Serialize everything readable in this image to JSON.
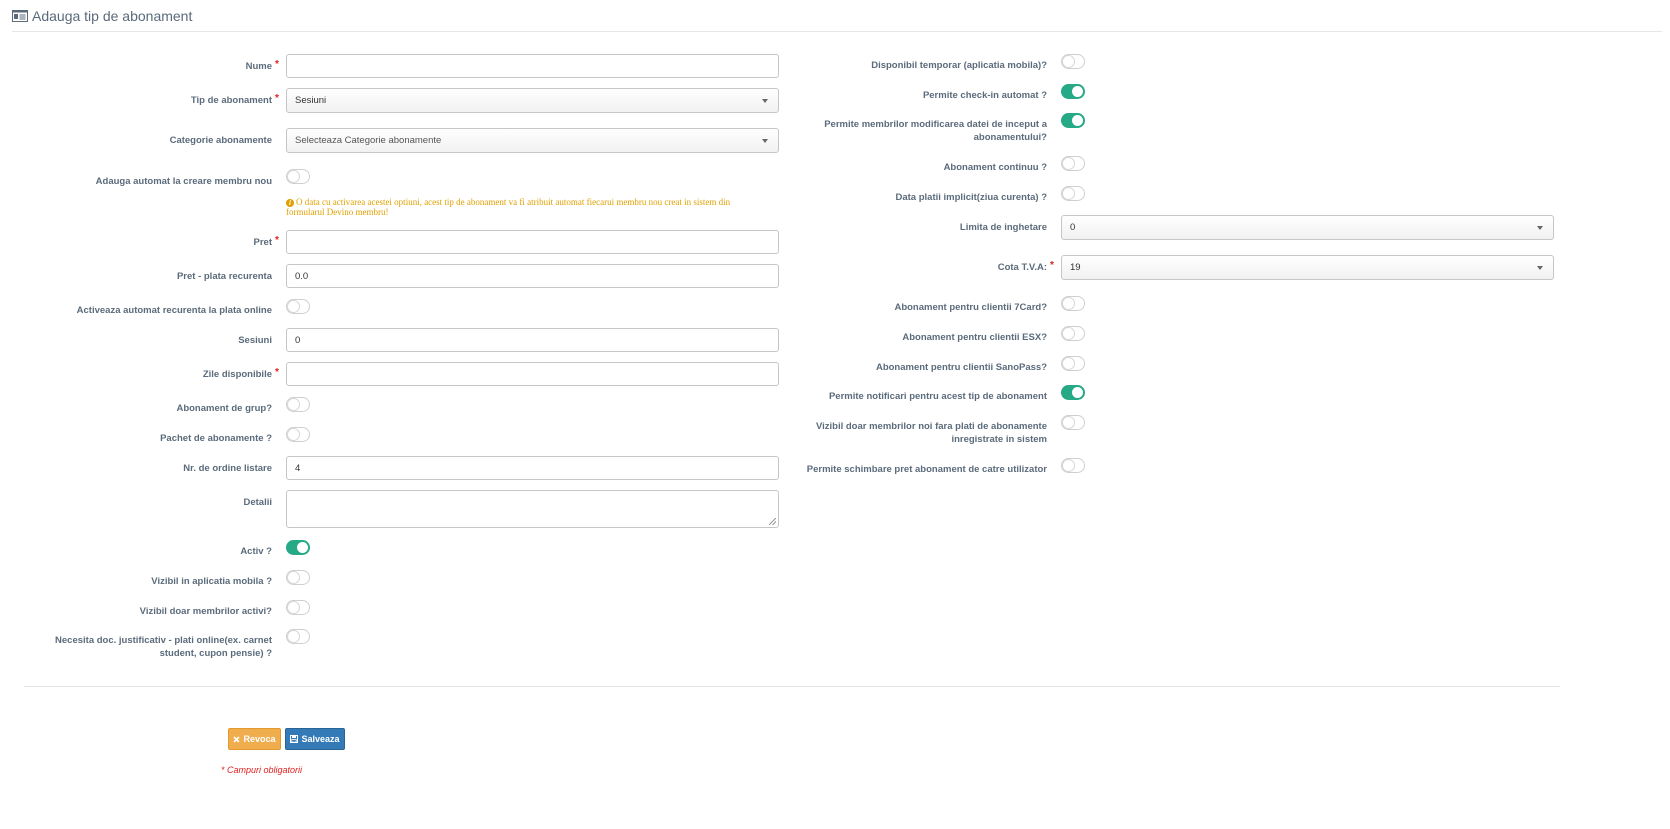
{
  "header": {
    "title": "Adauga tip de abonament",
    "icon": "id-card-icon"
  },
  "colors": {
    "accent": "#26a986",
    "required": "#e02020",
    "hint": "#e0a000",
    "cancel": "#f0ad4e",
    "save": "#337ab7"
  },
  "left": {
    "nume": {
      "label": "Nume",
      "value": ""
    },
    "tip": {
      "label": "Tip de abonament",
      "value": "Sesiuni"
    },
    "categorie": {
      "label": "Categorie abonamente",
      "value": "Selecteaza Categorie abonamente"
    },
    "adauga_auto": {
      "label": "Adauga automat la creare membru nou",
      "on": false
    },
    "hint": "O data cu activarea acestei optiuni, acest tip de abonament va fi atribuit automat fiecarui membru nou creat in sistem din formularul Devino membru!",
    "pret": {
      "label": "Pret",
      "value": ""
    },
    "pret_recurenta": {
      "label": "Pret - plata recurenta",
      "value": "0.0"
    },
    "activeaza_recurenta": {
      "label": "Activeaza automat recurenta la plata online",
      "on": false
    },
    "sesiuni": {
      "label": "Sesiuni",
      "value": "0"
    },
    "zile": {
      "label": "Zile disponibile",
      "value": ""
    },
    "grup": {
      "label": "Abonament de grup?",
      "on": false
    },
    "pachet": {
      "label": "Pachet de abonamente ?",
      "on": false
    },
    "ordine": {
      "label": "Nr. de ordine listare",
      "value": "4"
    },
    "detalii": {
      "label": "Detalii",
      "value": ""
    },
    "activ": {
      "label": "Activ ?",
      "on": true
    },
    "vizibil_app": {
      "label": "Vizibil in aplicatia mobila ?",
      "on": false
    },
    "vizibil_activi": {
      "label": "Vizibil doar membrilor activi?",
      "on": false
    },
    "necesita_doc": {
      "label_line1": "Necesita doc. justificativ - plati online(ex. carnet",
      "label_line2": "student, cupon pensie) ?",
      "on": false
    }
  },
  "right": {
    "disponibil_temp": {
      "label": "Disponibil temporar (aplicatia mobila)?",
      "on": false
    },
    "checkin": {
      "label": "Permite check-in automat ?",
      "on": true
    },
    "modificare_data": {
      "label_line1": "Permite membrilor modificarea datei de inceput a",
      "label_line2": "abonamentului?",
      "on": true
    },
    "continuu": {
      "label": "Abonament continuu ?",
      "on": false
    },
    "data_platii": {
      "label": "Data platii implicit(ziua curenta) ?",
      "on": false
    },
    "limita": {
      "label": "Limita de inghetare",
      "value": "0"
    },
    "tva": {
      "label": "Cota T.V.A:",
      "value": "19"
    },
    "card7": {
      "label": "Abonament pentru clientii 7Card?",
      "on": false
    },
    "esx": {
      "label": "Abonament pentru clientii ESX?",
      "on": false
    },
    "sanopass": {
      "label": "Abonament pentru clientii SanoPass?",
      "on": false
    },
    "notificari": {
      "label": "Permite notificari pentru acest tip de abonament",
      "on": true
    },
    "vizibil_noi": {
      "label_line1": "Vizibil doar membrilor noi fara plati de abonamente",
      "label_line2": "inregistrate in sistem",
      "on": false
    },
    "schimbare_pret": {
      "label": "Permite schimbare pret abonament de catre utilizator",
      "on": false
    }
  },
  "actions": {
    "cancel_label": "Revoca",
    "save_label": "Salveaza",
    "required_note": "* Campuri obligatorii"
  },
  "required_mark": "*"
}
